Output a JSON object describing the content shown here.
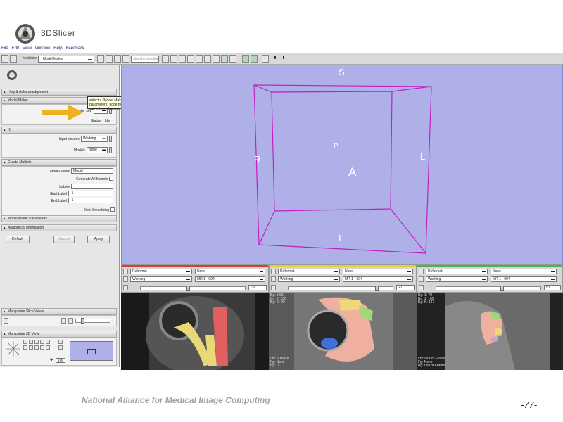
{
  "app": {
    "logo_text": "3DSlicer",
    "panel_logo_text": "3DSlicer"
  },
  "menu": [
    "File",
    "Edit",
    "View",
    "Window",
    "Help",
    "Feedback"
  ],
  "toolbar": {
    "modules_label": "Modules:",
    "module_selected": "Model Maker",
    "search_placeholder": "search modules"
  },
  "left_panel": {
    "help_section": "Help & Acknowledgement",
    "model_maker_section": "Model Maker",
    "parameter_set_label": "Parameter set",
    "status_label": "Status",
    "status_value": "Idle",
    "tooltip_text": "select a \"Model Maker parameters\" node from the current mrml scene",
    "io_section": "IO",
    "input_volume_label": "Input Volume",
    "input_volume_value": "Working",
    "models_label": "Models",
    "models_value": "None",
    "create_multiple_section": "Create Multiple",
    "model_prefix_label": "Model Prefix",
    "model_prefix_value": "Model",
    "generate_all_label": "Generate All Models",
    "labels_label": "Labels",
    "start_label_label": "Start Label",
    "start_label_value": "-1",
    "end_label_label": "End Label",
    "end_label_value": "-1",
    "joint_smoothing_label": "Joint Smoothing",
    "params_section": "Model Maker Parameters",
    "anatomical_section": "Anatomical Information",
    "default_btn": "Default",
    "cancel_btn": "Cancel",
    "apply_btn": "Apply",
    "manip_slice_section": "Manipulate Slice Views",
    "manip_3d_section": "Manipulate 3D View",
    "zoom_value": "100"
  },
  "view3d": {
    "S": "S",
    "I": "I",
    "R": "R",
    "L": "L",
    "A": "A",
    "P": "P"
  },
  "slices": [
    {
      "stripe": "#d83c3c",
      "orientation": "Reformat",
      "fg": "None",
      "bg": "Working",
      "label": "MR 1 - 004",
      "value": "-16",
      "info_top": [],
      "info_bottom": []
    },
    {
      "stripe": "#e0d040",
      "orientation": "Reformat",
      "fg": "None",
      "bg": "Working",
      "label": "MR 1 - 004",
      "value": "27",
      "info_top": [
        "Bg: 1:53",
        "Bg: 2: 150",
        "Bg: K: 90"
      ],
      "info_bottom": [
        "Lbl: 0 Brack",
        "Fg: None",
        "Bg: 0"
      ]
    },
    {
      "stripe": "#50b050",
      "orientation": "Reformat",
      "fg": "None",
      "bg": "Working",
      "label": "MR 1 - 004",
      "value": "51",
      "info_top": [
        "Bg: 1: 78",
        "Bg: J: 105",
        "Bg: K: 141"
      ],
      "info_bottom": [
        "Lbl: Out of Frame",
        "Fg: None",
        "Bg: Out of Frame"
      ]
    }
  ],
  "footer": {
    "org": "National Alliance for Medical Image Computing",
    "page": "-77-"
  },
  "colors": {
    "view_bg": "#b0b0e8",
    "box_line": "#c020c0",
    "arrow": "#f0b020"
  }
}
